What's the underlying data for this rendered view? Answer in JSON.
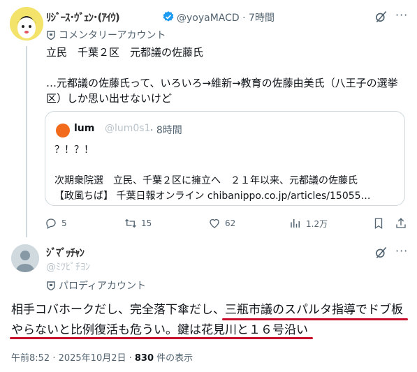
{
  "tweet1": {
    "display_name": "ﾘｼﾞｰｽ･ｳﾞｪﾝ･(ｱｲｳ)",
    "handle": "@yoyaMACD",
    "time": "7時間",
    "account_label": "コメンタリーアカウント",
    "text_line1": "立民　千葉２区　元都議の佐藤氏",
    "text_line2": "…元都議の佐藤氏って、いろいろ→維新→教育の佐藤由美氏（八王子の選挙区）しか思い出せないけど",
    "quote": {
      "name": "lum",
      "handle": "@lum0s1",
      "time": "· 8時間",
      "line1": "？！？！",
      "line2": "次期衆院選　立民、千葉２区に擁立へ　２１年以来、元都議の佐藤氏",
      "line3": "【政風ちば】 千葉日報オンライン chibanippo.co.jp/articles/15055…"
    },
    "actions": {
      "reply_count": "5",
      "repost_count": "15",
      "like_count": "62",
      "view_count": "1.2万"
    }
  },
  "tweet2": {
    "display_name": "ｼﾞﾏﾞｯﾁｬﾝ",
    "handle": "@ﾐﾂﾋﾟﾁﾖﾝ",
    "account_label": "パロディアカウント",
    "text_line1": "相手コバホークだし、完全落下傘だし、三瓶市議のスパルタ指導でドブ板",
    "text_line2": "やらないと比例復活も危うい。鍵は花見川と１６号沿い",
    "timestamp": "午前8:52 · 2025年10月2日 · ",
    "views": "830",
    "views_suffix": " 件の表示"
  },
  "colors": {
    "accent": "#1d9bf0",
    "underline": "#c8102e",
    "muted": "#536471"
  },
  "icons": [
    "verified-badge-icon",
    "grok-icon",
    "more-icon",
    "reply-icon",
    "repost-icon",
    "like-icon",
    "views-icon",
    "bookmark-icon",
    "share-icon",
    "account-shield-icon"
  ]
}
